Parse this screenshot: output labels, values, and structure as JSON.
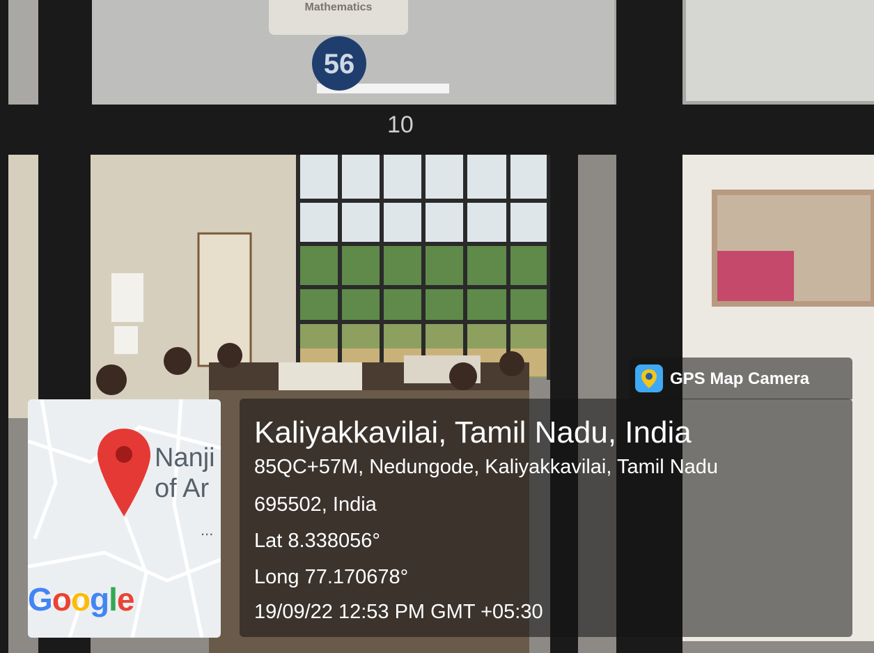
{
  "scene": {
    "door_sign": "Mathematics",
    "room_number": "56",
    "glass_mark": "10"
  },
  "stamp": {
    "brand": "GPS Map Camera",
    "brand_icon": "location-pin-icon",
    "place": "Kaliyakkavilai, Tamil Nadu, India",
    "address_line1": "85QC+57M, Nedungode, Kaliyakkavilai, Tamil Nadu",
    "address_line2": "695502, India",
    "latitude": "Lat 8.338056°",
    "longitude": "Long 77.170678°",
    "datetime": "19/09/22 12:53 PM GMT +05:30"
  },
  "map": {
    "label_line1": "Nanji",
    "label_line2": "of Ar",
    "more": "...",
    "pin_color": "#e53935",
    "google_letters": [
      "G",
      "o",
      "o",
      "g",
      "l",
      "e"
    ],
    "google_colors": [
      "#4285f4",
      "#ea4335",
      "#fbbc05",
      "#4285f4",
      "#34a853",
      "#ea4335"
    ]
  }
}
